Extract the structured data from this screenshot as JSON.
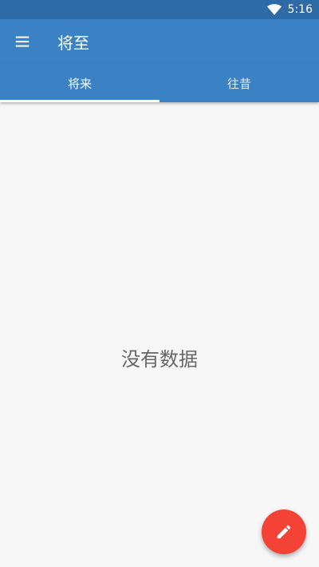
{
  "status_bar": {
    "time": "5:16",
    "wifi_icon": "wifi-icon"
  },
  "app_bar": {
    "title": "将至",
    "menu_icon": "menu-icon"
  },
  "tabs": [
    {
      "label": "将来",
      "selected": true
    },
    {
      "label": "往昔",
      "selected": false
    }
  ],
  "main": {
    "empty_message": "没有数据"
  },
  "fab": {
    "icon": "pencil-icon"
  },
  "colors": {
    "status_bar": "#2e6ba6",
    "app_bar": "#3b82c4",
    "background": "#f7f7f7",
    "fab": "#f44336"
  }
}
